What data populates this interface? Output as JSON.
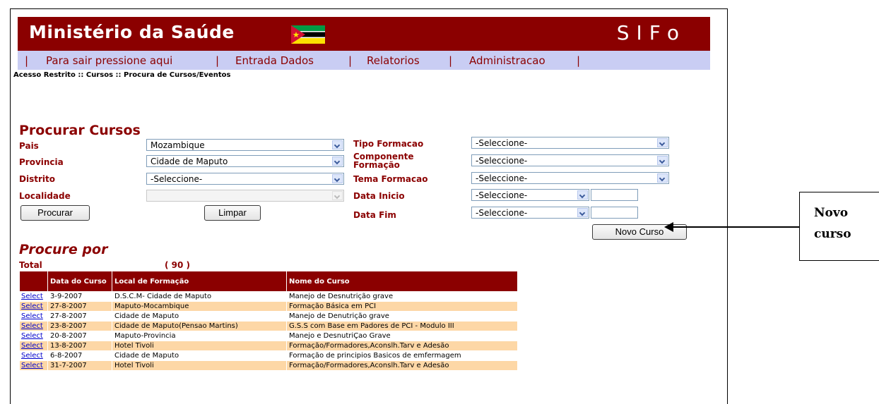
{
  "header": {
    "title": "Ministério da Saúde",
    "system": "SIFo"
  },
  "menu": {
    "sep": "|",
    "items": [
      "Para sair pressione aqui",
      "Entrada Dados",
      "Relatorios",
      "Administracao"
    ]
  },
  "breadcrumb": "Acesso Restrito :: Cursos :: Procura de Cursos/Eventos",
  "search": {
    "title": "Procurar Cursos",
    "pais": {
      "label": "Pais",
      "value": "Mozambique"
    },
    "provincia": {
      "label": "Provincia",
      "value": "Cidade de Maputo"
    },
    "distrito": {
      "label": "Distrito",
      "value": "-Seleccione-"
    },
    "localidade": {
      "label": "Localidade",
      "value": ""
    },
    "tipo": {
      "label": "Tipo Formacao",
      "value": "-Seleccione-"
    },
    "componente": {
      "label": "Componente Formação",
      "value": "-Seleccione-"
    },
    "tema": {
      "label": "Tema Formacao",
      "value": "-Seleccione-"
    },
    "data_inicio": {
      "label": "Data Inicio",
      "value": "-Seleccione-"
    },
    "data_fim": {
      "label": "Data Fim",
      "value": "-Seleccione-"
    },
    "procurar_btn": "Procurar",
    "limpar_btn": "Limpar",
    "novo_btn": "Novo Curso"
  },
  "results": {
    "title": "Procure por",
    "total_label": "Total",
    "total_value": "( 90 )",
    "columns": [
      "",
      "Data do Curso",
      "Local de Formação",
      "Nome do Curso"
    ],
    "select_label": "Select",
    "rows": [
      {
        "data": "3-9-2007",
        "local": "D.S.C.M- Cidade de Maputo",
        "nome": "Manejo de Desnutrição grave"
      },
      {
        "data": "27-8-2007",
        "local": "Maputo-Mocambique",
        "nome": "Formação Básica em PCI"
      },
      {
        "data": "27-8-2007",
        "local": "Cidade de Maputo",
        "nome": "Manejo de Denutrição grave"
      },
      {
        "data": "23-8-2007",
        "local": "Cidade de Maputo(Pensao Martins)",
        "nome": "G.S.S com Base em Padores de PCI - Modulo III"
      },
      {
        "data": "20-8-2007",
        "local": "Maputo-Provincia",
        "nome": "Manejo e DesnutriÇao Grave"
      },
      {
        "data": "13-8-2007",
        "local": "Hotel Tivoli",
        "nome": "Formação/Formadores,Aconslh.Tarv e Adesão"
      },
      {
        "data": "6-8-2007",
        "local": "Cidade de Maputo",
        "nome": "Formação de principios Basicos de emfermagem"
      },
      {
        "data": "31-7-2007",
        "local": "Hotel Tivoli",
        "nome": "Formação/Formadores,Aconslh.Tarv e Adesão"
      },
      {
        "data": "",
        "local": "",
        "nome": ""
      }
    ]
  },
  "annotation": {
    "line1": "Novo",
    "line2": "curso"
  },
  "colors": {
    "brand": "#8b0000",
    "menu_bg": "#c9cdf3",
    "row_alt": "#fdd7a6"
  }
}
